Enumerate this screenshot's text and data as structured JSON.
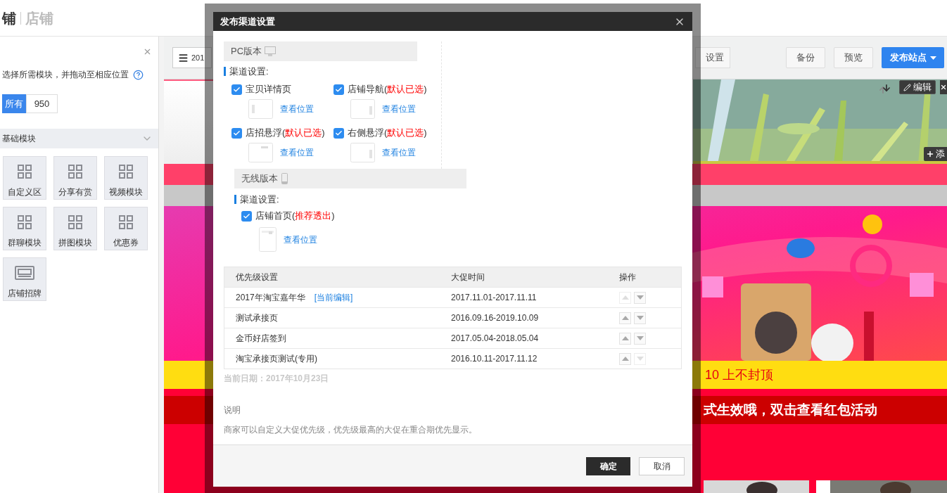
{
  "header": {
    "logo_text": "铺",
    "title": "店铺"
  },
  "module_panel": {
    "hint": "选择所需模块，并拖动至相应位置",
    "filter": {
      "label": "所有",
      "value": "950"
    },
    "section": {
      "title": "基础模块",
      "expanded": true
    },
    "modules": [
      {
        "label": "自定义区",
        "kind": "grid"
      },
      {
        "label": "分享有赏",
        "kind": "grid"
      },
      {
        "label": "视频模块",
        "kind": "grid"
      },
      {
        "label": "群聊模块",
        "kind": "grid"
      },
      {
        "label": "拼图模块",
        "kind": "grid"
      },
      {
        "label": "优惠券",
        "kind": "grid"
      },
      {
        "label": "店铺招牌",
        "kind": "banner"
      }
    ]
  },
  "toolbar": {
    "page_button": "201",
    "partial_button": "设置",
    "buttons": [
      {
        "label": "备份",
        "kind": "plain"
      },
      {
        "label": "预览",
        "kind": "plain"
      },
      {
        "label": "发布站点",
        "kind": "primary"
      }
    ]
  },
  "canvas": {
    "edit_button": "编辑",
    "add_button": "添",
    "promo_line": "10 上不封顶",
    "notice": "式生效哦，双击查看红包活动"
  },
  "dialog": {
    "title": "发布渠道设置",
    "pc": {
      "title": "PC版本",
      "channel_label": "渠道设置:",
      "options": [
        {
          "label": "宝贝详情页",
          "checked": true,
          "link": "查看位置",
          "kind": "left"
        },
        {
          "label": "店铺导航(",
          "note": "默认已选",
          "suffix": ")",
          "checked": true,
          "link": "查看位置",
          "kind": "right"
        },
        {
          "label": "店招悬浮(",
          "note": "默认已选",
          "suffix": ")",
          "checked": true,
          "link": "查看位置",
          "kind": "top"
        },
        {
          "label": "右侧悬浮(",
          "note": "默认已选",
          "suffix": ")",
          "checked": true,
          "link": "查看位置",
          "kind": "right"
        }
      ]
    },
    "mobile": {
      "title": "无线版本",
      "channel_label": "渠道设置:",
      "options": [
        {
          "label": "店铺首页(",
          "note": "推荐透出",
          "suffix": ")",
          "checked": true,
          "link": "查看位置",
          "kind": "mobile"
        }
      ]
    },
    "table": {
      "columns": [
        "优先级设置",
        "大促时间",
        "操作"
      ],
      "rows": [
        {
          "name": "2017年淘宝嘉年华",
          "tag": "[当前编辑]",
          "time": "2017.11.01-2017.11.11",
          "up_disabled": true,
          "down_disabled": false
        },
        {
          "name": "测试承接页",
          "time": "2016.09.16-2019.10.09",
          "up_disabled": false,
          "down_disabled": false
        },
        {
          "name": "金币好店签到",
          "time": "2017.05.04-2018.05.04",
          "up_disabled": false,
          "down_disabled": false
        },
        {
          "name": "淘宝承接页测试(专用)",
          "time": "2016.10.11-2017.11.12",
          "up_disabled": false,
          "down_disabled": true
        }
      ]
    },
    "date_note": "当前日期：2017年10月23日",
    "explanation_title": "说明",
    "explanation": "商家可以自定义大促优先级，优先级最高的大促在重合期优先显示。",
    "buttons": [
      {
        "label": "确定",
        "kind": "primary"
      },
      {
        "label": "取消",
        "kind": "default"
      }
    ]
  }
}
